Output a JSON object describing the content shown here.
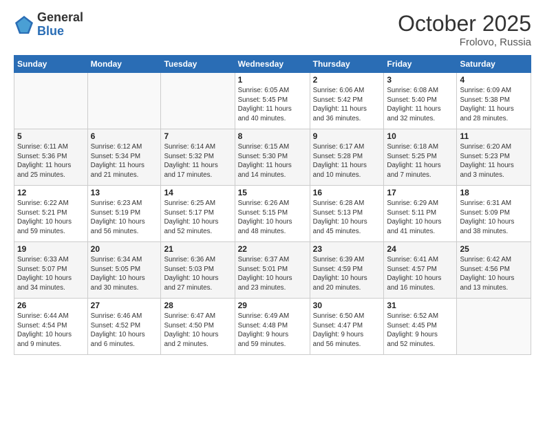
{
  "header": {
    "logo_general": "General",
    "logo_blue": "Blue",
    "month": "October 2025",
    "location": "Frolovo, Russia"
  },
  "weekdays": [
    "Sunday",
    "Monday",
    "Tuesday",
    "Wednesday",
    "Thursday",
    "Friday",
    "Saturday"
  ],
  "weeks": [
    [
      {
        "day": "",
        "info": ""
      },
      {
        "day": "",
        "info": ""
      },
      {
        "day": "",
        "info": ""
      },
      {
        "day": "1",
        "info": "Sunrise: 6:05 AM\nSunset: 5:45 PM\nDaylight: 11 hours\nand 40 minutes."
      },
      {
        "day": "2",
        "info": "Sunrise: 6:06 AM\nSunset: 5:42 PM\nDaylight: 11 hours\nand 36 minutes."
      },
      {
        "day": "3",
        "info": "Sunrise: 6:08 AM\nSunset: 5:40 PM\nDaylight: 11 hours\nand 32 minutes."
      },
      {
        "day": "4",
        "info": "Sunrise: 6:09 AM\nSunset: 5:38 PM\nDaylight: 11 hours\nand 28 minutes."
      }
    ],
    [
      {
        "day": "5",
        "info": "Sunrise: 6:11 AM\nSunset: 5:36 PM\nDaylight: 11 hours\nand 25 minutes."
      },
      {
        "day": "6",
        "info": "Sunrise: 6:12 AM\nSunset: 5:34 PM\nDaylight: 11 hours\nand 21 minutes."
      },
      {
        "day": "7",
        "info": "Sunrise: 6:14 AM\nSunset: 5:32 PM\nDaylight: 11 hours\nand 17 minutes."
      },
      {
        "day": "8",
        "info": "Sunrise: 6:15 AM\nSunset: 5:30 PM\nDaylight: 11 hours\nand 14 minutes."
      },
      {
        "day": "9",
        "info": "Sunrise: 6:17 AM\nSunset: 5:28 PM\nDaylight: 11 hours\nand 10 minutes."
      },
      {
        "day": "10",
        "info": "Sunrise: 6:18 AM\nSunset: 5:25 PM\nDaylight: 11 hours\nand 7 minutes."
      },
      {
        "day": "11",
        "info": "Sunrise: 6:20 AM\nSunset: 5:23 PM\nDaylight: 11 hours\nand 3 minutes."
      }
    ],
    [
      {
        "day": "12",
        "info": "Sunrise: 6:22 AM\nSunset: 5:21 PM\nDaylight: 10 hours\nand 59 minutes."
      },
      {
        "day": "13",
        "info": "Sunrise: 6:23 AM\nSunset: 5:19 PM\nDaylight: 10 hours\nand 56 minutes."
      },
      {
        "day": "14",
        "info": "Sunrise: 6:25 AM\nSunset: 5:17 PM\nDaylight: 10 hours\nand 52 minutes."
      },
      {
        "day": "15",
        "info": "Sunrise: 6:26 AM\nSunset: 5:15 PM\nDaylight: 10 hours\nand 48 minutes."
      },
      {
        "day": "16",
        "info": "Sunrise: 6:28 AM\nSunset: 5:13 PM\nDaylight: 10 hours\nand 45 minutes."
      },
      {
        "day": "17",
        "info": "Sunrise: 6:29 AM\nSunset: 5:11 PM\nDaylight: 10 hours\nand 41 minutes."
      },
      {
        "day": "18",
        "info": "Sunrise: 6:31 AM\nSunset: 5:09 PM\nDaylight: 10 hours\nand 38 minutes."
      }
    ],
    [
      {
        "day": "19",
        "info": "Sunrise: 6:33 AM\nSunset: 5:07 PM\nDaylight: 10 hours\nand 34 minutes."
      },
      {
        "day": "20",
        "info": "Sunrise: 6:34 AM\nSunset: 5:05 PM\nDaylight: 10 hours\nand 30 minutes."
      },
      {
        "day": "21",
        "info": "Sunrise: 6:36 AM\nSunset: 5:03 PM\nDaylight: 10 hours\nand 27 minutes."
      },
      {
        "day": "22",
        "info": "Sunrise: 6:37 AM\nSunset: 5:01 PM\nDaylight: 10 hours\nand 23 minutes."
      },
      {
        "day": "23",
        "info": "Sunrise: 6:39 AM\nSunset: 4:59 PM\nDaylight: 10 hours\nand 20 minutes."
      },
      {
        "day": "24",
        "info": "Sunrise: 6:41 AM\nSunset: 4:57 PM\nDaylight: 10 hours\nand 16 minutes."
      },
      {
        "day": "25",
        "info": "Sunrise: 6:42 AM\nSunset: 4:56 PM\nDaylight: 10 hours\nand 13 minutes."
      }
    ],
    [
      {
        "day": "26",
        "info": "Sunrise: 6:44 AM\nSunset: 4:54 PM\nDaylight: 10 hours\nand 9 minutes."
      },
      {
        "day": "27",
        "info": "Sunrise: 6:46 AM\nSunset: 4:52 PM\nDaylight: 10 hours\nand 6 minutes."
      },
      {
        "day": "28",
        "info": "Sunrise: 6:47 AM\nSunset: 4:50 PM\nDaylight: 10 hours\nand 2 minutes."
      },
      {
        "day": "29",
        "info": "Sunrise: 6:49 AM\nSunset: 4:48 PM\nDaylight: 9 hours\nand 59 minutes."
      },
      {
        "day": "30",
        "info": "Sunrise: 6:50 AM\nSunset: 4:47 PM\nDaylight: 9 hours\nand 56 minutes."
      },
      {
        "day": "31",
        "info": "Sunrise: 6:52 AM\nSunset: 4:45 PM\nDaylight: 9 hours\nand 52 minutes."
      },
      {
        "day": "",
        "info": ""
      }
    ]
  ]
}
